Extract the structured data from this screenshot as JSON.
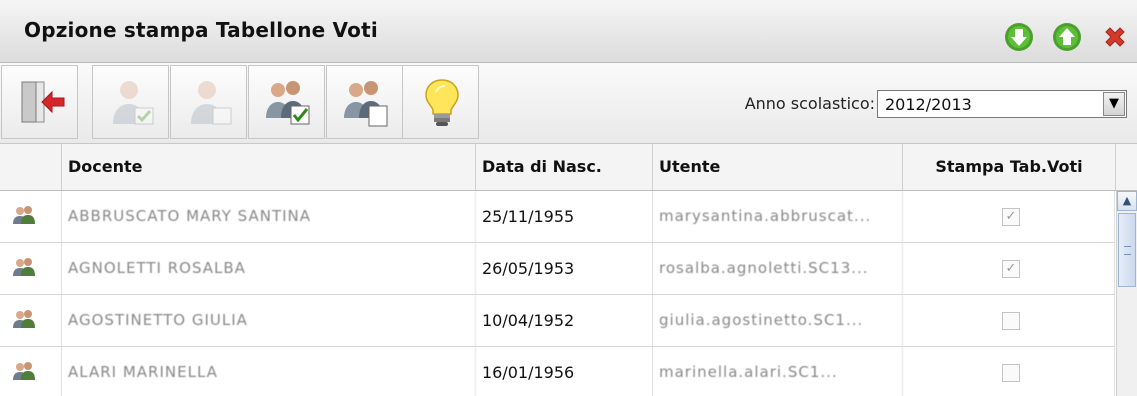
{
  "window": {
    "title": "Opzione stampa Tabellone Voti",
    "controls": [
      {
        "name": "down-arrow-icon",
        "color": "#4aa02c"
      },
      {
        "name": "up-arrow-icon",
        "color": "#4aa02c"
      },
      {
        "name": "close-icon",
        "color": "#d43a2a"
      }
    ]
  },
  "toolbar": {
    "tools": [
      {
        "name": "exit-door-icon",
        "enabled": true
      },
      {
        "name": "user-check-icon",
        "enabled": false
      },
      {
        "name": "user-blank-icon",
        "enabled": false
      },
      {
        "name": "users-check-icon",
        "enabled": true
      },
      {
        "name": "users-document-icon",
        "enabled": true
      },
      {
        "name": "lightbulb-icon",
        "enabled": true
      }
    ],
    "anno_label": "Anno scolastico:",
    "anno_value": "2012/2013"
  },
  "table": {
    "columns": [
      "Docente",
      "Data di Nasc.",
      "Utente",
      "Stampa Tab.Voti"
    ],
    "rows": [
      {
        "docente": "ABBRUSCATO MARY SANTINA",
        "data": "25/11/1955",
        "utente": "marysantina.abbruscat...",
        "stampa": true
      },
      {
        "docente": "AGNOLETTI ROSALBA",
        "data": "26/05/1953",
        "utente": "rosalba.agnoletti.SC13...",
        "stampa": true
      },
      {
        "docente": "AGOSTINETTO GIULIA",
        "data": "10/04/1952",
        "utente": "giulia.agostinetto.SC1...",
        "stampa": false
      },
      {
        "docente": "ALARI MARINELLA",
        "data": "16/01/1956",
        "utente": "marinella.alari.SC1...",
        "stampa": false
      }
    ]
  }
}
